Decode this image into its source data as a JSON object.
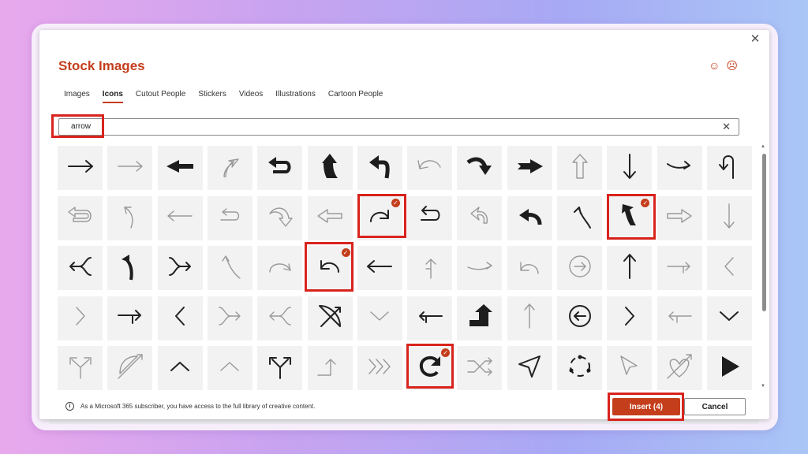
{
  "dialog": {
    "title": "Stock Images",
    "close_icon": "close-icon",
    "feedback_icons": [
      "smile-icon",
      "frown-icon"
    ]
  },
  "tabs": [
    {
      "label": "Images",
      "active": false
    },
    {
      "label": "Icons",
      "active": true
    },
    {
      "label": "Cutout People",
      "active": false
    },
    {
      "label": "Stickers",
      "active": false
    },
    {
      "label": "Videos",
      "active": false
    },
    {
      "label": "Illustrations",
      "active": false
    },
    {
      "label": "Cartoon People",
      "active": false
    }
  ],
  "search": {
    "value": "arrow",
    "clear_icon": "clear-icon"
  },
  "grid": {
    "columns": 14,
    "icons": [
      {
        "name": "arrow-right-icon"
      },
      {
        "name": "arrow-right-thin-icon"
      },
      {
        "name": "arrow-left-bold-icon"
      },
      {
        "name": "arrow-up-curved-outline-icon"
      },
      {
        "name": "u-turn-left-bold-icon"
      },
      {
        "name": "arrow-up-bold-icon"
      },
      {
        "name": "arrow-turn-left-bold-icon"
      },
      {
        "name": "arrow-curved-outline-icon"
      },
      {
        "name": "arrow-curve-down-bold-icon"
      },
      {
        "name": "arrow-right-bold-icon"
      },
      {
        "name": "arrow-up-outline-icon"
      },
      {
        "name": "arrow-down-icon"
      },
      {
        "name": "arrow-right-curved-icon"
      },
      {
        "name": "arrow-turn-up-left-icon"
      },
      {
        "name": "u-turn-left-outline-icon"
      },
      {
        "name": "arrow-up-curved-thin-icon"
      },
      {
        "name": "arrow-left-thin-icon"
      },
      {
        "name": "u-turn-outline-icon"
      },
      {
        "name": "arrow-curve-down-outline-icon"
      },
      {
        "name": "arrow-left-outline-icon"
      },
      {
        "name": "arrow-redo-icon",
        "selected": true
      },
      {
        "name": "u-turn-left-icon"
      },
      {
        "name": "arrow-turn-outline-icon"
      },
      {
        "name": "arrow-curve-left-bold-icon"
      },
      {
        "name": "arrow-curve-up-left-icon"
      },
      {
        "name": "arrow-up-left-bold-icon",
        "selected": true
      },
      {
        "name": "arrow-right-outline-icon"
      },
      {
        "name": "arrow-down-thin-icon"
      },
      {
        "name": "merge-left-icon"
      },
      {
        "name": "arrow-up-curve-bold-icon"
      },
      {
        "name": "merge-right-icon"
      },
      {
        "name": "arrow-curve-up-thin-icon"
      },
      {
        "name": "arrow-circle-right-thin-icon"
      },
      {
        "name": "arrow-undo-icon",
        "selected": true
      },
      {
        "name": "arrow-left-icon"
      },
      {
        "name": "arrow-turn-up-thin-icon"
      },
      {
        "name": "arrow-right-curve-thin-icon"
      },
      {
        "name": "arrow-undo-thin-icon"
      },
      {
        "name": "circle-arrow-right-icon"
      },
      {
        "name": "arrow-up-icon"
      },
      {
        "name": "arrow-turn-right-thin-icon"
      },
      {
        "name": "chevron-left-thin-icon"
      },
      {
        "name": "chevron-right-thin-icon"
      },
      {
        "name": "arrow-turn-right-icon"
      },
      {
        "name": "chevron-left-icon"
      },
      {
        "name": "merge-right-thin-icon"
      },
      {
        "name": "merge-left-thin-icon"
      },
      {
        "name": "bow-arrow-icon"
      },
      {
        "name": "chevron-down-thin-icon"
      },
      {
        "name": "arrow-turn-left-icon"
      },
      {
        "name": "arrow-up-right-bold-icon"
      },
      {
        "name": "arrow-up-thin-icon"
      },
      {
        "name": "circle-arrow-left-icon"
      },
      {
        "name": "chevron-right-icon"
      },
      {
        "name": "arrow-turn-left-thin-icon"
      },
      {
        "name": "chevron-down-icon"
      },
      {
        "name": "split-arrow-icon"
      },
      {
        "name": "bow-arrow-outline-icon"
      },
      {
        "name": "chevron-up-icon"
      },
      {
        "name": "chevron-up-thin-icon"
      },
      {
        "name": "split-arrow-bold-icon"
      },
      {
        "name": "arrow-step-up-icon"
      },
      {
        "name": "triple-chevron-right-icon"
      },
      {
        "name": "arrow-refresh-icon",
        "selected": true
      },
      {
        "name": "shuffle-icon"
      },
      {
        "name": "navigation-arrow-icon"
      },
      {
        "name": "cycle-arrows-icon"
      },
      {
        "name": "cursor-arrow-icon"
      },
      {
        "name": "heart-arrow-icon"
      },
      {
        "name": "play-arrow-icon"
      }
    ]
  },
  "footer": {
    "info_text": "As a Microsoft 365 subscriber, you have access to the full library of creative content.",
    "insert_label": "Insert (4)",
    "cancel_label": "Cancel"
  },
  "colors": {
    "accent": "#c43e1c",
    "highlight": "#d9231d",
    "tile": "#f2f2f2"
  }
}
